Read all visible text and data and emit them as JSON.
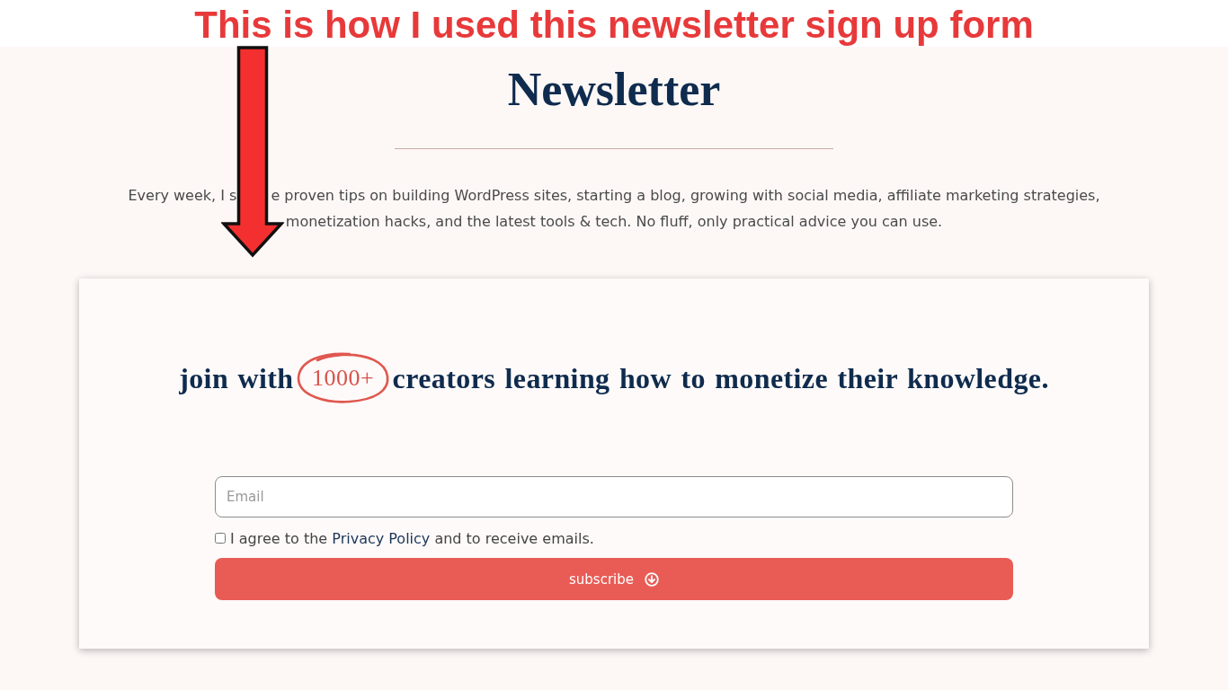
{
  "annotation": {
    "title": "This is how I used this newsletter sign up form"
  },
  "section": {
    "heading": "Newsletter",
    "description_lines": [
      {
        "parts": [
          "Every week, I s",
          "e proven tips on building WordPress sites, starting a blog, growing with social media, affiliate marketing strategies,"
        ]
      },
      {
        "parts": [
          "monetization hacks, and the latest tools & tech. No fluff, only practical advice you can use."
        ]
      }
    ]
  },
  "form": {
    "headline": [
      {
        "kind": "plain",
        "text": "join with"
      },
      {
        "kind": "circled",
        "text": "1000+"
      },
      {
        "kind": "plain",
        "text": "creators learning how to monetize their knowledge."
      }
    ],
    "email": {
      "placeholder": "Email"
    },
    "consent": {
      "checked": false,
      "parts": [
        {
          "kind": "text",
          "text": "I agree to the"
        },
        {
          "kind": "link",
          "text": "Privacy Policy"
        },
        {
          "kind": "text",
          "text": "and to receive emails."
        }
      ]
    },
    "button": {
      "label": "subscribe"
    }
  }
}
